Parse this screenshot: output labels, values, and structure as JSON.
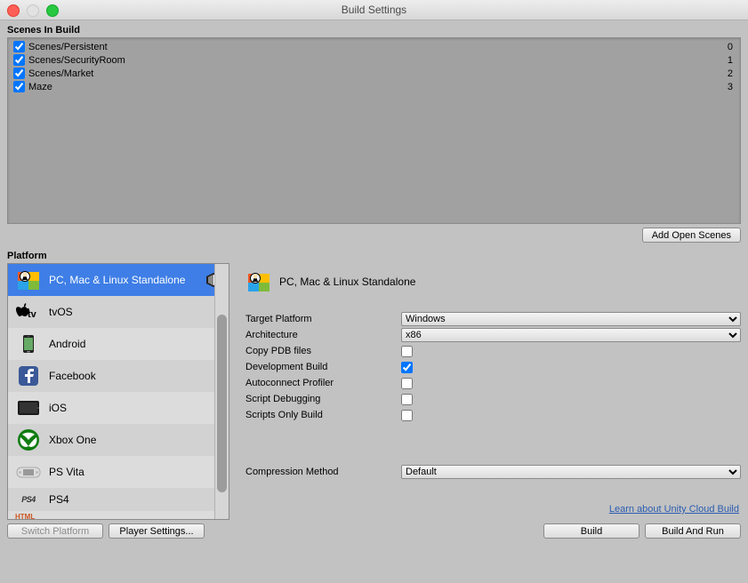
{
  "window": {
    "title": "Build Settings"
  },
  "scenes": {
    "header": "Scenes In Build",
    "add_button": "Add Open Scenes",
    "items": [
      {
        "label": "Scenes/Persistent",
        "checked": true,
        "index": "0"
      },
      {
        "label": "Scenes/SecurityRoom",
        "checked": true,
        "index": "1"
      },
      {
        "label": "Scenes/Market",
        "checked": true,
        "index": "2"
      },
      {
        "label": "Maze",
        "checked": true,
        "index": "3"
      }
    ]
  },
  "platform": {
    "header": "Platform",
    "items": [
      {
        "label": "PC, Mac & Linux Standalone",
        "selected": true,
        "icon": "standalone"
      },
      {
        "label": "tvOS",
        "selected": false,
        "icon": "tvos"
      },
      {
        "label": "Android",
        "selected": false,
        "icon": "android"
      },
      {
        "label": "Facebook",
        "selected": false,
        "icon": "facebook"
      },
      {
        "label": "iOS",
        "selected": false,
        "icon": "ios"
      },
      {
        "label": "Xbox One",
        "selected": false,
        "icon": "xbox"
      },
      {
        "label": "PS Vita",
        "selected": false,
        "icon": "psvita"
      },
      {
        "label": "PS4",
        "selected": false,
        "icon": "ps4"
      }
    ],
    "html_label": "HTML"
  },
  "settings": {
    "title": "PC, Mac & Linux Standalone",
    "rows": {
      "target_platform": {
        "label": "Target Platform",
        "value": "Windows"
      },
      "architecture": {
        "label": "Architecture",
        "value": "x86"
      },
      "copy_pdb": {
        "label": "Copy PDB files",
        "checked": false
      },
      "dev_build": {
        "label": "Development Build",
        "checked": true
      },
      "autoconnect": {
        "label": "Autoconnect Profiler",
        "checked": false
      },
      "script_debug": {
        "label": "Script Debugging",
        "checked": false
      },
      "scripts_only": {
        "label": "Scripts Only Build",
        "checked": false
      },
      "compression": {
        "label": "Compression Method",
        "value": "Default"
      }
    },
    "cloud_link": "Learn about Unity Cloud Build"
  },
  "buttons": {
    "switch_platform": "Switch Platform",
    "player_settings": "Player Settings...",
    "build": "Build",
    "build_and_run": "Build And Run"
  }
}
